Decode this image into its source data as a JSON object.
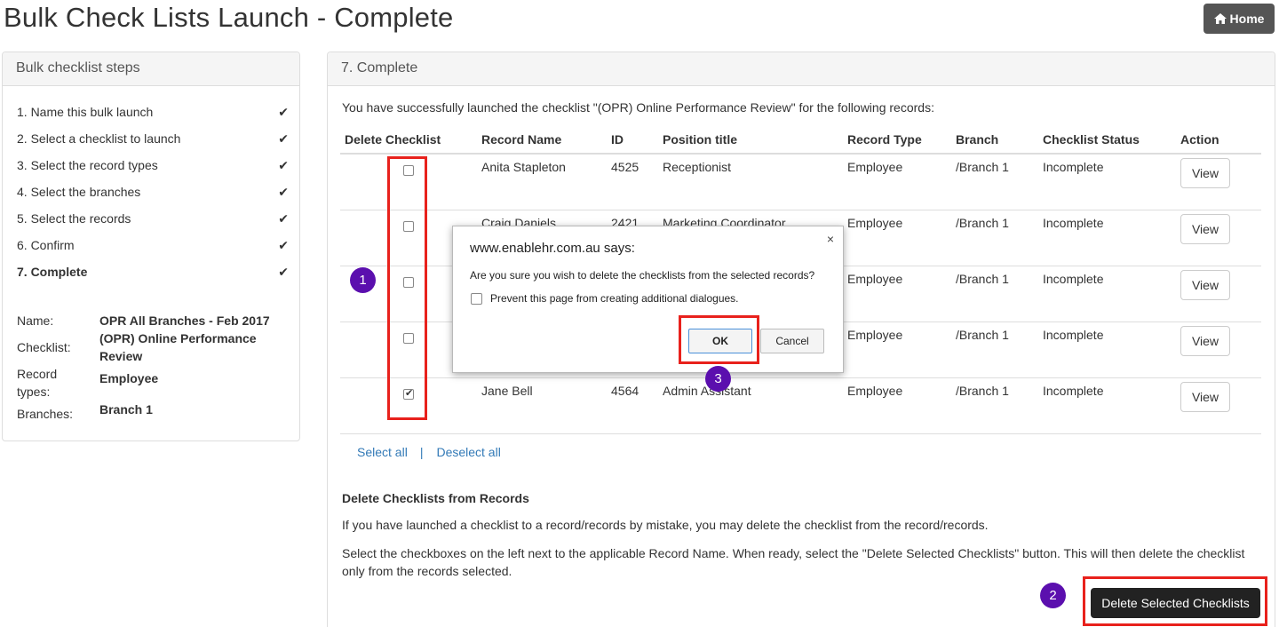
{
  "page": {
    "title": "Bulk Check Lists Launch - Complete",
    "home_label": "Home"
  },
  "steps_panel": {
    "heading": "Bulk checklist steps",
    "steps": [
      {
        "label": "1. Name this bulk launch",
        "done": true
      },
      {
        "label": "2. Select a checklist to launch",
        "done": true
      },
      {
        "label": "3. Select the record types",
        "done": true
      },
      {
        "label": "4. Select the branches",
        "done": true
      },
      {
        "label": "5. Select the records",
        "done": true
      },
      {
        "label": "6. Confirm",
        "done": true
      },
      {
        "label": "7. Complete",
        "done": true
      }
    ],
    "summary": {
      "name_label": "Name:",
      "name_value": "OPR All Branches - Feb 2017",
      "checklist_label": "Checklist:",
      "checklist_value": "(OPR) Online Performance Review",
      "record_types_label": "Record types:",
      "record_types_value": "Employee",
      "branches_label": "Branches:",
      "branches_value": "Branch 1"
    }
  },
  "main_panel": {
    "heading": "7. Complete",
    "intro": "You have successfully launched the checklist \"(OPR) Online Performance Review\" for the following records:",
    "columns": [
      "Delete Checklist",
      "Record Name",
      "ID",
      "Position title",
      "Record Type",
      "Branch",
      "Checklist Status",
      "Action"
    ],
    "rows": [
      {
        "checked": false,
        "name": "Anita Stapleton",
        "id": "4525",
        "position": "Receptionist",
        "type": "Employee",
        "branch": "/Branch 1",
        "status": "Incomplete",
        "action": "View"
      },
      {
        "checked": false,
        "name": "Craig Daniels",
        "id": "2421",
        "position": "Marketing Coordinator",
        "type": "Employee",
        "branch": "/Branch 1",
        "status": "Incomplete",
        "action": "View"
      },
      {
        "checked": false,
        "name": "",
        "id": "",
        "position": "",
        "type": "Employee",
        "branch": "/Branch 1",
        "status": "Incomplete",
        "action": "View"
      },
      {
        "checked": false,
        "name": "",
        "id": "",
        "position": "",
        "type": "Employee",
        "branch": "/Branch 1",
        "status": "Incomplete",
        "action": "View"
      },
      {
        "checked": true,
        "name": "Jane Bell",
        "id": "4564",
        "position": "Admin Assistant",
        "type": "Employee",
        "branch": "/Branch 1",
        "status": "Incomplete",
        "action": "View"
      }
    ],
    "select_all": "Select all",
    "separator": "|",
    "deselect_all": "Deselect all",
    "delete_heading": "Delete Checklists from Records",
    "delete_para1": "If you have launched a checklist to a record/records by mistake, you may delete the checklist from the record/records.",
    "delete_para2": "Select the checkboxes on the left next to the applicable Record Name. When ready, select the \"Delete Selected Checklists\" button. This will then delete the checklist only from the records selected.",
    "delete_button": "Delete Selected Checklists"
  },
  "dialog": {
    "title": "www.enablehr.com.au says:",
    "close": "×",
    "message": "Are you sure you wish to delete the checklists from the selected records?",
    "prevent_label": "Prevent this page from creating additional dialogues.",
    "ok_label": "OK",
    "cancel_label": "Cancel"
  },
  "annotations": {
    "badge1": "1",
    "badge2": "2",
    "badge3": "3",
    "highlight_color": "#e8211c",
    "badge_color": "#5b0fae"
  }
}
